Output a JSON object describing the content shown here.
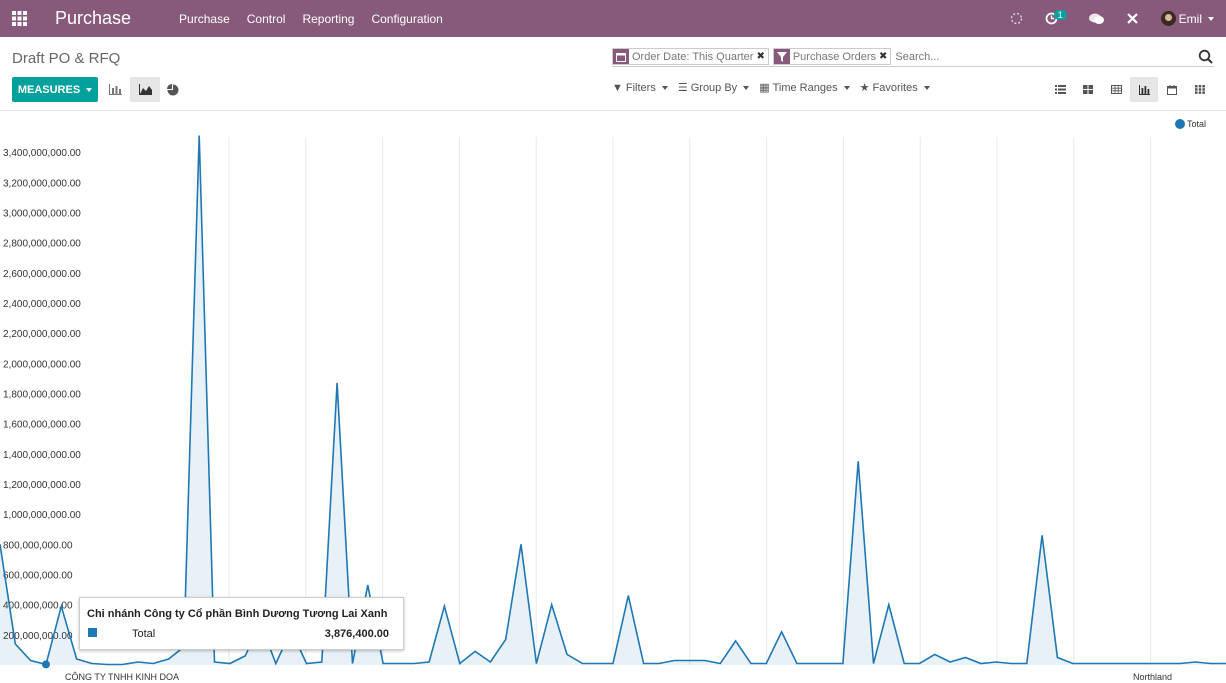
{
  "navbar": {
    "app_name": "Purchase",
    "menu": [
      "Purchase",
      "Control",
      "Reporting",
      "Configuration"
    ],
    "messages_badge": "1",
    "user": "Emil"
  },
  "control": {
    "breadcrumb": "Draft PO & RFQ",
    "facets": [
      "Order Date: This Quarter",
      "Purchase Orders"
    ],
    "search_placeholder": "Search...",
    "measures_label": "MEASURES",
    "filters": [
      "Filters",
      "Group By",
      "Time Ranges",
      "Favorites"
    ]
  },
  "tooltip": {
    "title": "Chi nhánh Công ty Cổ phần Bình Dương Tương Lai Xanh",
    "label": "Total",
    "value": "3,876,400.00"
  },
  "colors": {
    "brand": "#875a7b",
    "accent": "#00a09d",
    "series": "#1f77b4"
  },
  "chart_data": {
    "type": "area",
    "legend": [
      "Total"
    ],
    "legend_position": "top-right",
    "ylim": [
      0,
      3500000000
    ],
    "y_ticks": [
      "200,000,000.00",
      "400,000,000.00",
      "600,000,000.00",
      "800,000,000.00",
      "1,000,000,000.00",
      "1,200,000,000.00",
      "1,400,000,000.00",
      "1,600,000,000.00",
      "1,800,000,000.00",
      "2,000,000,000.00",
      "2,200,000,000.00",
      "2,400,000,000.00",
      "2,600,000,000.00",
      "2,800,000,000.00",
      "3,000,000,000.00",
      "3,200,000,000.00",
      "3,400,000,000.00"
    ],
    "x_first_label": "CÔNG TY TNHH KINH DOA",
    "x_last_label": "Northland",
    "series": [
      {
        "name": "Total",
        "values": [
          800000000,
          140000000,
          30000000,
          3876400,
          390000000,
          40000000,
          10000000,
          3000000,
          3000000,
          20000000,
          10000000,
          40000000,
          120000000,
          3510000000,
          20000000,
          10000000,
          60000000,
          280000000,
          10000000,
          230000000,
          10000000,
          20000000,
          1870000000,
          10000000,
          530000000,
          10000000,
          10000000,
          10000000,
          20000000,
          390000000,
          10000000,
          90000000,
          20000000,
          170000000,
          800000000,
          10000000,
          400000000,
          70000000,
          10000000,
          10000000,
          10000000,
          460000000,
          10000000,
          10000000,
          30000000,
          30000000,
          30000000,
          10000000,
          160000000,
          10000000,
          10000000,
          220000000,
          10000000,
          10000000,
          10000000,
          10000000,
          1350000000,
          10000000,
          400000000,
          10000000,
          10000000,
          70000000,
          20000000,
          50000000,
          10000000,
          20000000,
          10000000,
          10000000,
          860000000,
          50000000,
          10000000,
          10000000,
          10000000,
          10000000,
          10000000,
          10000000,
          10000000,
          10000000,
          20000000,
          10000000,
          10000000
        ]
      }
    ]
  }
}
